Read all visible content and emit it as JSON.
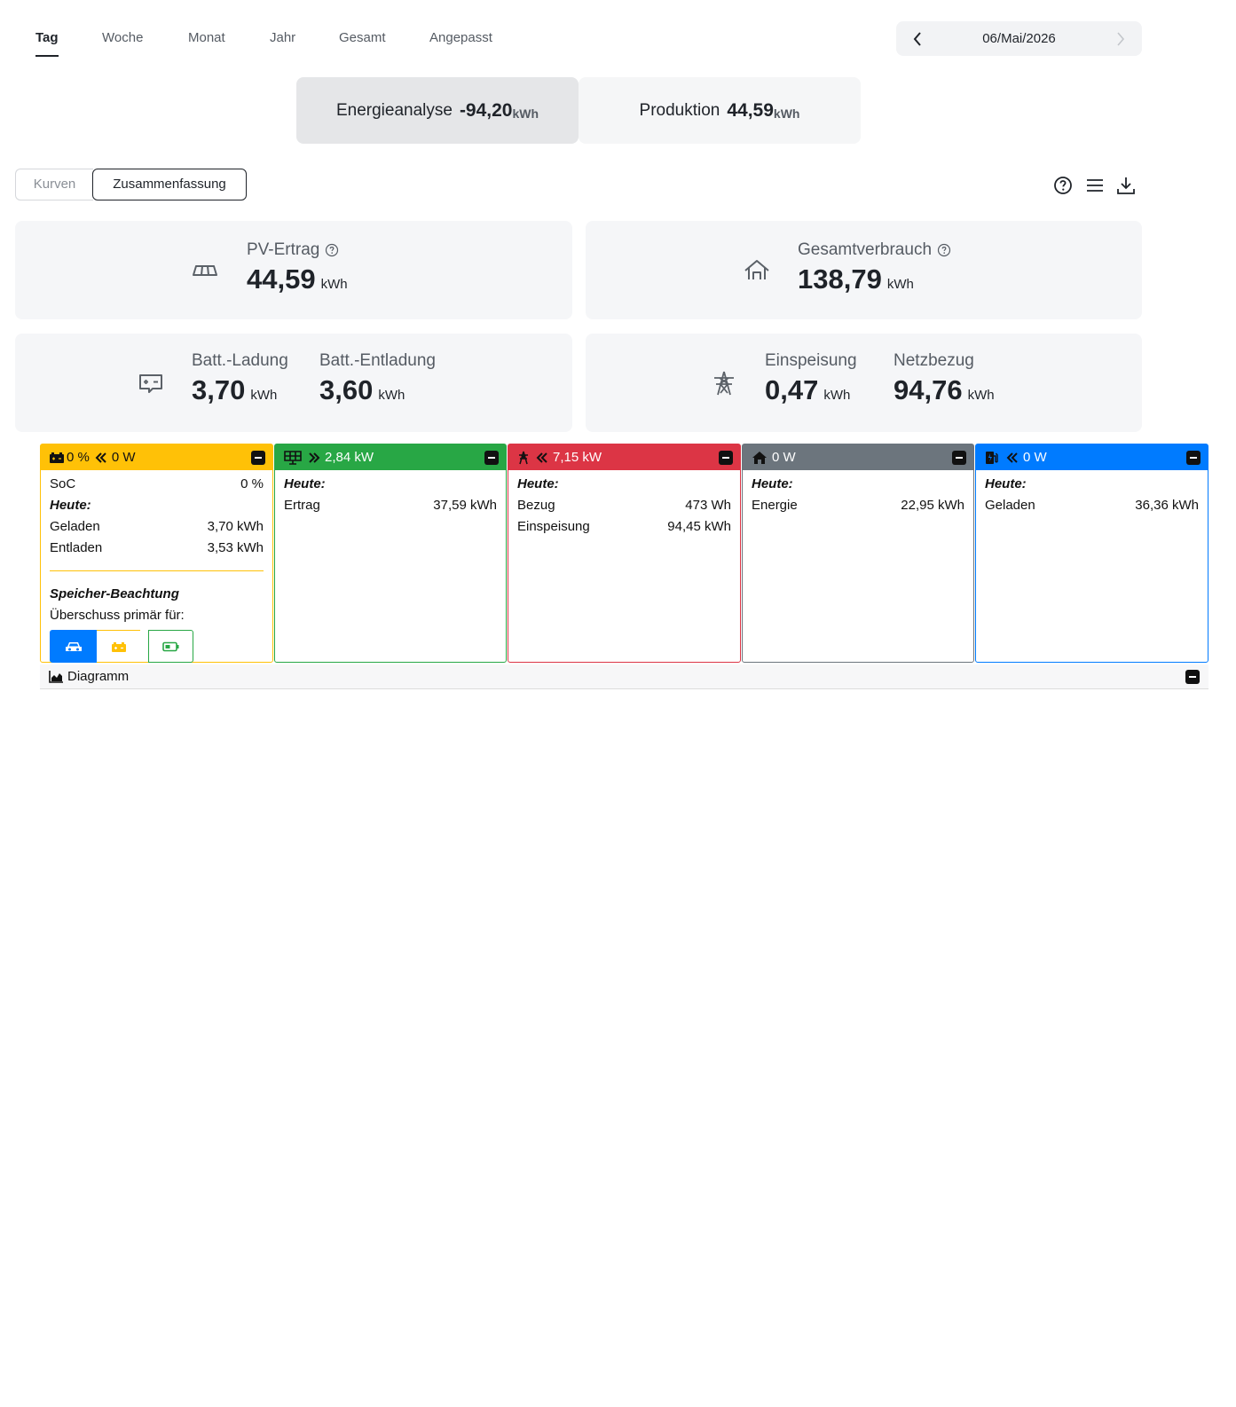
{
  "period_tabs": [
    "Tag",
    "Woche",
    "Monat",
    "Jahr",
    "Gesamt",
    "Angepasst"
  ],
  "active_period": "Tag",
  "date": "06/Mai/2026",
  "analysis": {
    "energy_label": "Energieanalyse",
    "energy_value": "-94,20",
    "energy_unit": "kWh",
    "production_label": "Produktion",
    "production_value": "44,59",
    "production_unit": "kWh"
  },
  "view_toggle": {
    "curves": "Kurven",
    "summary": "Zusammenfassung",
    "active": "summary"
  },
  "toolbar_icons": [
    "help-icon",
    "menu-icon",
    "download-icon"
  ],
  "stats": {
    "pv": {
      "label": "PV-Ertrag",
      "value": "44,59",
      "unit": "kWh"
    },
    "consumption": {
      "label": "Gesamtverbrauch",
      "value": "138,79",
      "unit": "kWh"
    },
    "batt_charge": {
      "label": "Batt.-Ladung",
      "value": "3,70",
      "unit": "kWh"
    },
    "batt_discharge": {
      "label": "Batt.-Entladung",
      "value": "3,60",
      "unit": "kWh"
    },
    "feed_in": {
      "label": "Einspeisung",
      "value": "0,47",
      "unit": "kWh"
    },
    "grid_import": {
      "label": "Netzbezug",
      "value": "94,76",
      "unit": "kWh"
    }
  },
  "panels": {
    "battery": {
      "color": "#ffc107",
      "header_soc": "0 %",
      "header_power": "0 W",
      "soc_label": "SoC",
      "soc_value": "0 %",
      "today_label": "Heute:",
      "charged_label": "Geladen",
      "charged_value": "3,70 kWh",
      "discharged_label": "Entladen",
      "discharged_value": "3,53 kWh",
      "priority_title": "Speicher-Beachtung",
      "priority_text": "Überschuss primär für:",
      "priority_active": "car"
    },
    "pv": {
      "color": "#28a745",
      "header_power": "2,84 kW",
      "today_label": "Heute:",
      "yield_label": "Ertrag",
      "yield_value": "37,59 kWh"
    },
    "grid": {
      "color": "#dc3545",
      "header_power": "7,15 kW",
      "today_label": "Heute:",
      "import_label": "Bezug",
      "import_value": "473 Wh",
      "export_label": "Einspeisung",
      "export_value": "94,45 kWh"
    },
    "house": {
      "color": "#6c757d",
      "header_power": "0 W",
      "today_label": "Heute:",
      "energy_label": "Energie",
      "energy_value": "22,95 kWh"
    },
    "charger": {
      "color": "#007bff",
      "header_power": "0 W",
      "today_label": "Heute:",
      "charged_label": "Geladen",
      "charged_value": "36,36 kWh"
    }
  },
  "diagram_label": "Diagramm"
}
